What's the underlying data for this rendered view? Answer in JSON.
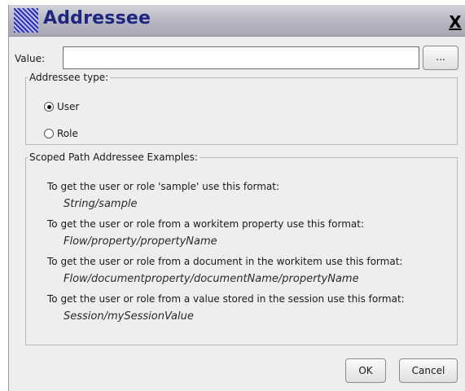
{
  "dialog": {
    "title": "Addressee",
    "close_label": "X"
  },
  "value_field": {
    "label": "Value:",
    "value": "",
    "browse_label": "..."
  },
  "addressee_type": {
    "legend": "Addressee type:",
    "options": [
      {
        "label": "User",
        "checked": true
      },
      {
        "label": "Role",
        "checked": false
      }
    ]
  },
  "examples": {
    "legend": "Scoped Path Addressee Examples:",
    "items": [
      {
        "description": "To get the user or role 'sample' use this format:",
        "format": "String/sample"
      },
      {
        "description": "To get the user or role from a workitem property use this format:",
        "format": "Flow/property/propertyName"
      },
      {
        "description": "To get the user or role from a document in the workitem use this format:",
        "format": "Flow/documentproperty/documentName/propertyName"
      },
      {
        "description": "To get the user or role from a value stored in the session use this format:",
        "format": "Session/mySessionValue"
      }
    ]
  },
  "buttons": {
    "ok_label": "OK",
    "cancel_label": "Cancel"
  },
  "colors": {
    "title_text": "#1e2680",
    "dialog_bg": "#eeeeee"
  }
}
